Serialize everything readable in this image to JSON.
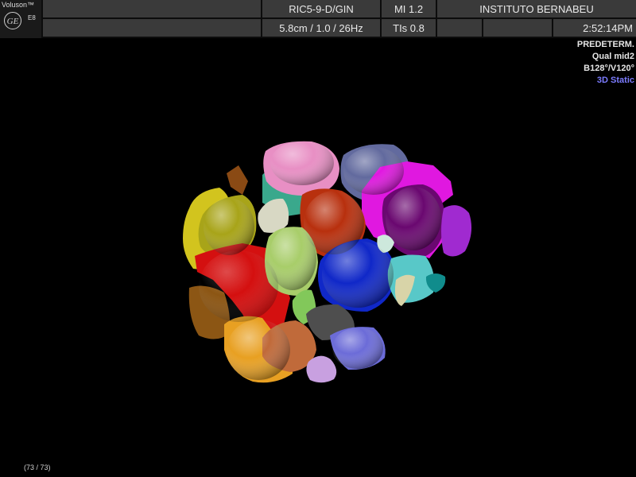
{
  "header": {
    "brand": "Voluson™",
    "model": "E8",
    "probe": "RIC5-9-D/GIN",
    "mi": "MI  1.2",
    "institution": "INSTITUTO BERNABEU",
    "params": "5.8cm / 1.0 / 26Hz",
    "tis": "TIs  0.8",
    "time": "2:52:14PM"
  },
  "info": {
    "preset": "PREDETERM.",
    "quality": "Qual mid2",
    "angles": "B128°/V120°",
    "mode": "3D Static"
  },
  "footer": {
    "frame": "(73 / 73)"
  },
  "colors": {
    "mode_text": "#7c7cff",
    "panel": "#3a3a3a"
  }
}
